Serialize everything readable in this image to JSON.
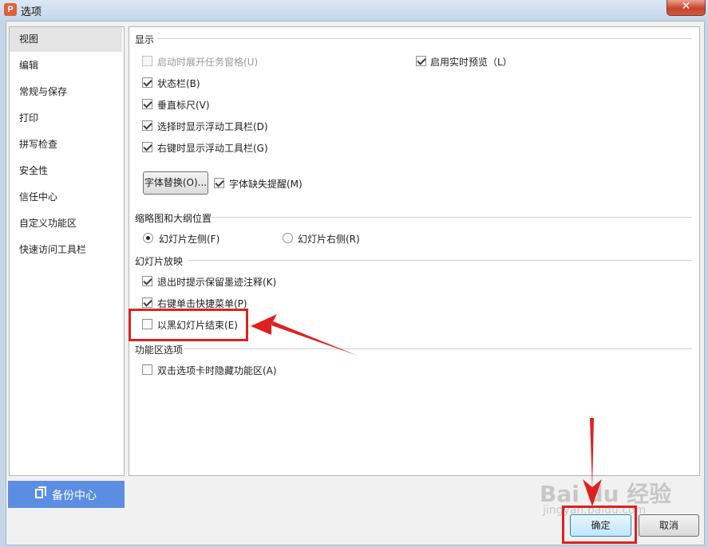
{
  "window": {
    "title": "选项",
    "close_glyph": "✕",
    "app_icon": "P"
  },
  "sidebar": {
    "items": [
      {
        "label": "视图",
        "active": true
      },
      {
        "label": "编辑"
      },
      {
        "label": "常规与保存"
      },
      {
        "label": "打印"
      },
      {
        "label": "拼写检查"
      },
      {
        "label": "安全性"
      },
      {
        "label": "信任中心"
      },
      {
        "label": "自定义功能区"
      },
      {
        "label": "快速访问工具栏"
      }
    ],
    "backup_label": "备份中心"
  },
  "display": {
    "title": "显示",
    "taskpane": {
      "label": "启动时展开任务窗格(U)",
      "checked": false,
      "disabled": true
    },
    "live_preview": {
      "label": "启用实时预览（L）",
      "checked": true
    },
    "status_bar": {
      "label": "状态栏(B)",
      "checked": true
    },
    "vertical_ruler": {
      "label": "垂直标尺(V)",
      "checked": true
    },
    "float_toolbar_select": {
      "label": "选择时显示浮动工具栏(D)",
      "checked": true
    },
    "float_toolbar_rightclick": {
      "label": "右键时显示浮动工具栏(G)",
      "checked": true
    },
    "font_replace_button": "字体替换(O)...",
    "font_missing": {
      "label": "字体缺失提醒(M)",
      "checked": true
    }
  },
  "thumbnail": {
    "title": "缩略图和大纲位置",
    "left": {
      "label": "幻灯片左侧(F)",
      "selected": true
    },
    "right": {
      "label": "幻灯片右侧(R)",
      "selected": false
    }
  },
  "slideshow": {
    "title": "幻灯片放映",
    "ink_prompt": {
      "label": "退出时提示保留墨迹注释(K)",
      "checked": true
    },
    "rightclick_menu": {
      "label": "右键单击快捷菜单(P)",
      "checked": true
    },
    "end_black": {
      "label": "以黑幻灯片结束(E)",
      "checked": false
    }
  },
  "ribbon": {
    "title": "功能区选项",
    "hide_on_dblclick": {
      "label": "双击选项卡时隐藏功能区(A)",
      "checked": false
    }
  },
  "buttons": {
    "ok": "确定",
    "cancel": "取消"
  },
  "watermark": {
    "main": "Bai du 经验",
    "sub": "jingyan.baidu.com"
  },
  "annotation_color": "#e02020"
}
